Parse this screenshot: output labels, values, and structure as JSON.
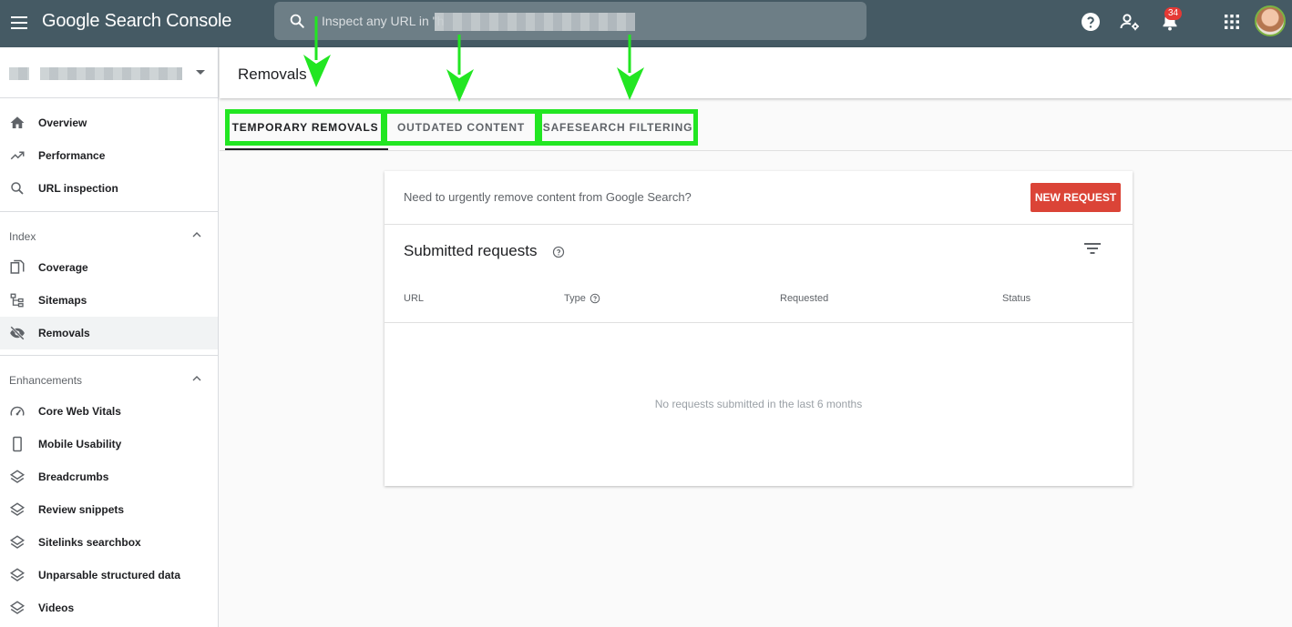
{
  "app": {
    "title": "Google Search Console"
  },
  "search": {
    "placeholder": "Inspect any URL in \"h"
  },
  "topbar": {
    "notifications_count": "34",
    "icons": [
      "menu-icon",
      "search-icon",
      "help-icon",
      "manage-users-icon",
      "notifications-icon",
      "apps-grid-icon",
      "avatar"
    ]
  },
  "sidebar": {
    "top_items": [
      {
        "label": "Overview",
        "icon": "home-icon"
      },
      {
        "label": "Performance",
        "icon": "trending-up-icon"
      },
      {
        "label": "URL inspection",
        "icon": "search-icon"
      }
    ],
    "index": {
      "label": "Index",
      "items": [
        {
          "label": "Coverage",
          "icon": "file-copy-icon"
        },
        {
          "label": "Sitemaps",
          "icon": "sitemap-icon"
        },
        {
          "label": "Removals",
          "icon": "visibility-off-icon",
          "active": true
        }
      ]
    },
    "enhancements": {
      "label": "Enhancements",
      "items": [
        {
          "label": "Core Web Vitals",
          "icon": "speed-gauge-icon"
        },
        {
          "label": "Mobile Usability",
          "icon": "smartphone-icon"
        },
        {
          "label": "Breadcrumbs",
          "icon": "layers-icon"
        },
        {
          "label": "Review snippets",
          "icon": "layers-icon"
        },
        {
          "label": "Sitelinks searchbox",
          "icon": "layers-icon"
        },
        {
          "label": "Unparsable structured data",
          "icon": "layers-icon"
        },
        {
          "label": "Videos",
          "icon": "layers-icon"
        }
      ]
    }
  },
  "main": {
    "page_title": "Removals",
    "tabs": [
      {
        "label": "TEMPORARY REMOVALS",
        "active": true
      },
      {
        "label": "OUTDATED CONTENT",
        "active": false
      },
      {
        "label": "SAFESEARCH FILTERING",
        "active": false
      }
    ],
    "card": {
      "prompt": "Need to urgently remove content from Google Search?",
      "new_request_label": "NEW REQUEST",
      "submitted_title": "Submitted requests",
      "columns": [
        "URL",
        "Type",
        "Requested",
        "Status"
      ],
      "empty_message": "No requests submitted in the last 6 months"
    }
  },
  "colors": {
    "topbar": "#455a64",
    "accent_red": "#db4437",
    "annotation_green": "#22e622",
    "badge_red": "#e53935"
  }
}
